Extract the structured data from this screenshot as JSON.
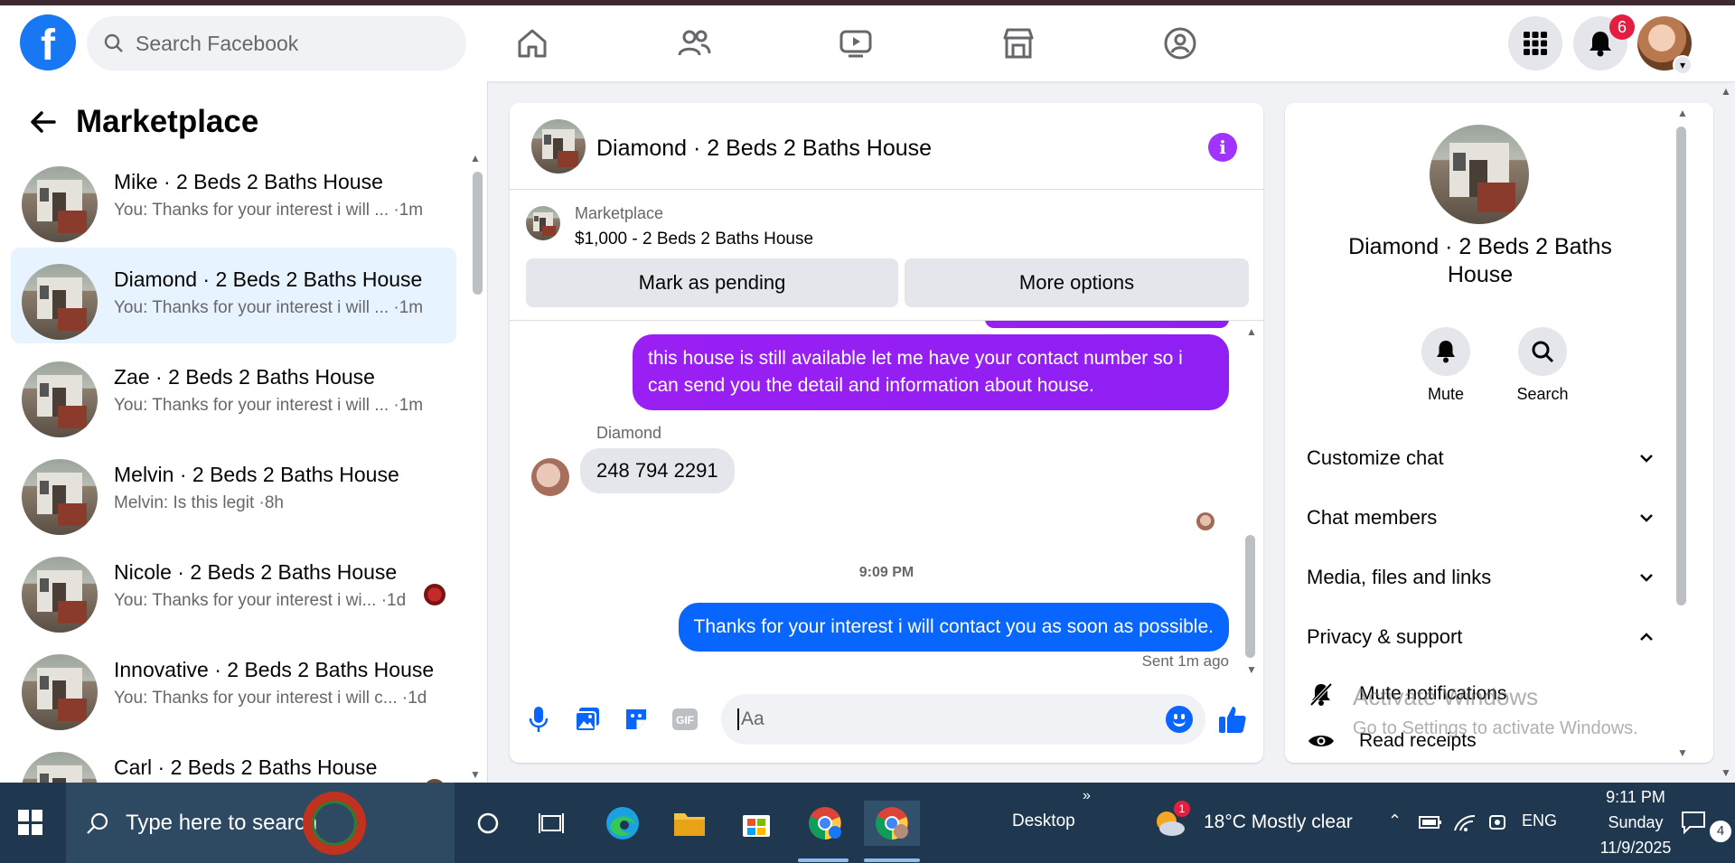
{
  "topnav": {
    "search_placeholder": "Search Facebook",
    "notification_count": "6"
  },
  "sidebar": {
    "title": "Marketplace",
    "conversations": [
      {
        "title": "Mike · 2 Beds 2 Baths House",
        "preview": "You: Thanks for your interest i will ... ·1m",
        "active": false
      },
      {
        "title": "Diamond · 2 Beds 2 Baths House",
        "preview": "You: Thanks for your interest i will ... ·1m",
        "active": true
      },
      {
        "title": "Zae · 2 Beds 2 Baths House",
        "preview": "You: Thanks for your interest i will ... ·1m",
        "active": false
      },
      {
        "title": "Melvin · 2 Beds 2 Baths House",
        "preview": "Melvin: Is this legit ·8h",
        "active": false
      },
      {
        "title": "Nicole · 2 Beds 2 Baths House",
        "preview": "You: Thanks for your interest i wi... ·1d",
        "active": false
      },
      {
        "title": "Innovative · 2 Beds 2 Baths House",
        "preview": "You: Thanks for your interest i will c... ·1d",
        "active": false
      },
      {
        "title": "Carl · 2 Beds 2 Baths House",
        "preview": "",
        "active": false
      }
    ]
  },
  "chat": {
    "title": "Diamond · 2 Beds 2 Baths House",
    "listing_label": "Marketplace",
    "listing_price": "$1,000 - 2 Beds 2 Baths House",
    "mark_pending_label": "Mark as pending",
    "more_options_label": "More options",
    "messages": {
      "out_1": "this house is still available let me have your contact number so i can send you the detail and information about house.",
      "sender_name": "Diamond",
      "in_1": "248 794 2291",
      "time_divider": "9:09 PM",
      "out_2": "Thanks for your interest i will contact you as soon as possible.",
      "status": "Sent 1m ago"
    },
    "composer_placeholder": "Aa"
  },
  "details": {
    "title": "Diamond · 2 Beds 2 Baths House",
    "mute_label": "Mute",
    "search_label": "Search",
    "sections": [
      "Customize chat",
      "Chat members",
      "Media, files and links",
      "Privacy & support"
    ],
    "sub_items": [
      "Mute notifications",
      "Read receipts"
    ],
    "watermark_title": "Activate Windows",
    "watermark_sub": "Go to Settings to activate Windows."
  },
  "taskbar": {
    "search_placeholder": "Type here to search",
    "desktop_label": "Desktop",
    "weather": "18°C  Mostly clear",
    "weather_badge": "1",
    "language": "ENG",
    "time": "9:11 PM",
    "day": "Sunday",
    "date": "11/9/2025",
    "notification_count": "4"
  },
  "colors": {
    "facebook_blue": "#1877f2",
    "messenger_purple": "#9a1ff3",
    "messenger_blue": "#0866ff",
    "active_conversation": "#e7f3ff",
    "taskbar": "#1f3850"
  }
}
